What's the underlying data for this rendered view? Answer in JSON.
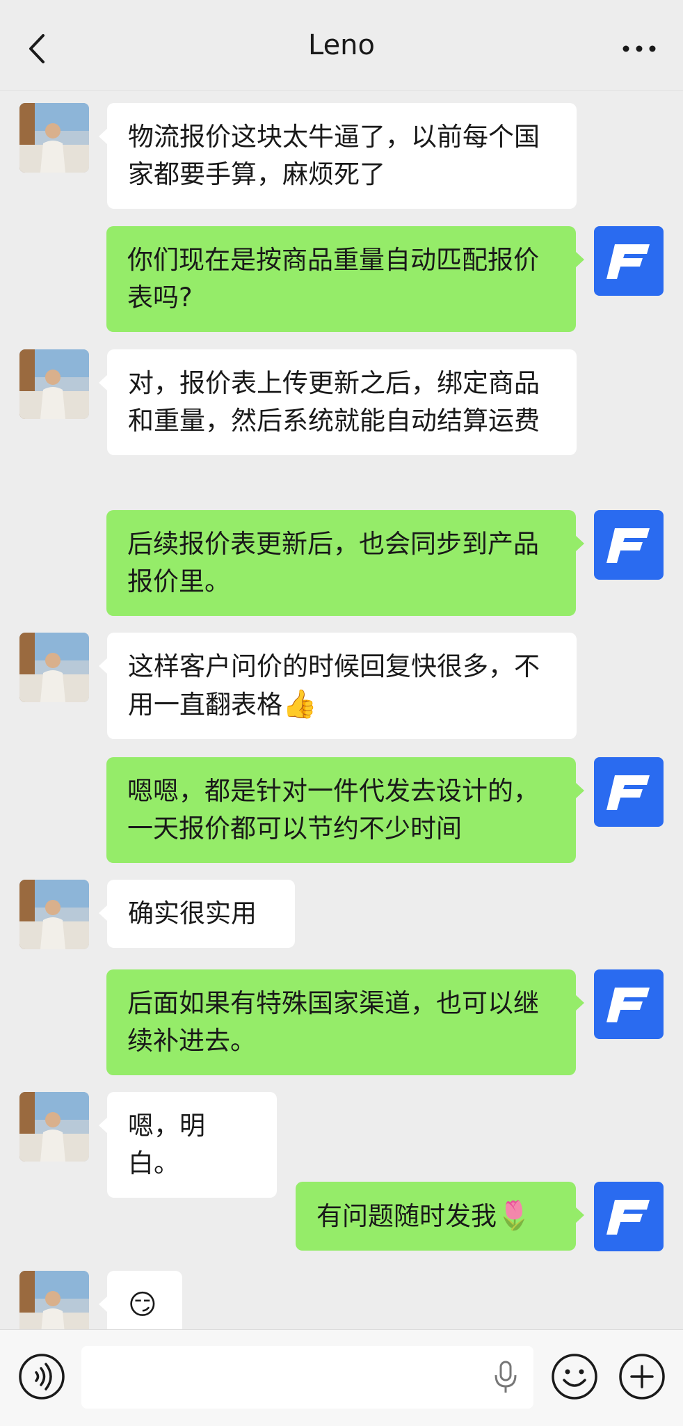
{
  "header": {
    "title": "Leno",
    "back_icon": "chevron-left-icon",
    "more_icon": "more-dots-icon"
  },
  "colors": {
    "background": "#ededed",
    "incoming_bubble": "#ffffff",
    "outgoing_bubble": "#95ec69",
    "brand_blue": "#2a6bf0"
  },
  "messages": [
    {
      "side": "in",
      "text": "物流报价这块太牛逼了，以前每个国家都要手算，麻烦死了"
    },
    {
      "side": "out",
      "text": "你们现在是按商品重量自动匹配报价表吗?"
    },
    {
      "side": "in",
      "text": "对，报价表上传更新之后，绑定商品和重量，然后系统就能自动结算运费"
    },
    {
      "side": "out",
      "text": "后续报价表更新后，也会同步到产品报价里。"
    },
    {
      "side": "in",
      "text": "这样客户问价的时候回复快很多，不用一直翻表格",
      "emoji": "👍"
    },
    {
      "side": "out",
      "text": "嗯嗯，都是针对一件代发去设计的，一天报价都可以节约不少时间"
    },
    {
      "side": "in",
      "text": "确实很实用"
    },
    {
      "side": "out",
      "text": "后面如果有特殊国家渠道，也可以继续补进去。"
    },
    {
      "side": "in",
      "text": "嗯，明白。"
    },
    {
      "side": "out",
      "text": "有问题随时发我",
      "emoji": "🌷"
    },
    {
      "side": "in",
      "text": "",
      "emoji": "😏"
    }
  ],
  "bottom_bar": {
    "voice_icon": "voice-toggle-icon",
    "input_value": "",
    "mic_icon": "microphone-icon",
    "emoji_icon": "emoji-smile-icon",
    "plus_icon": "plus-circle-icon"
  }
}
